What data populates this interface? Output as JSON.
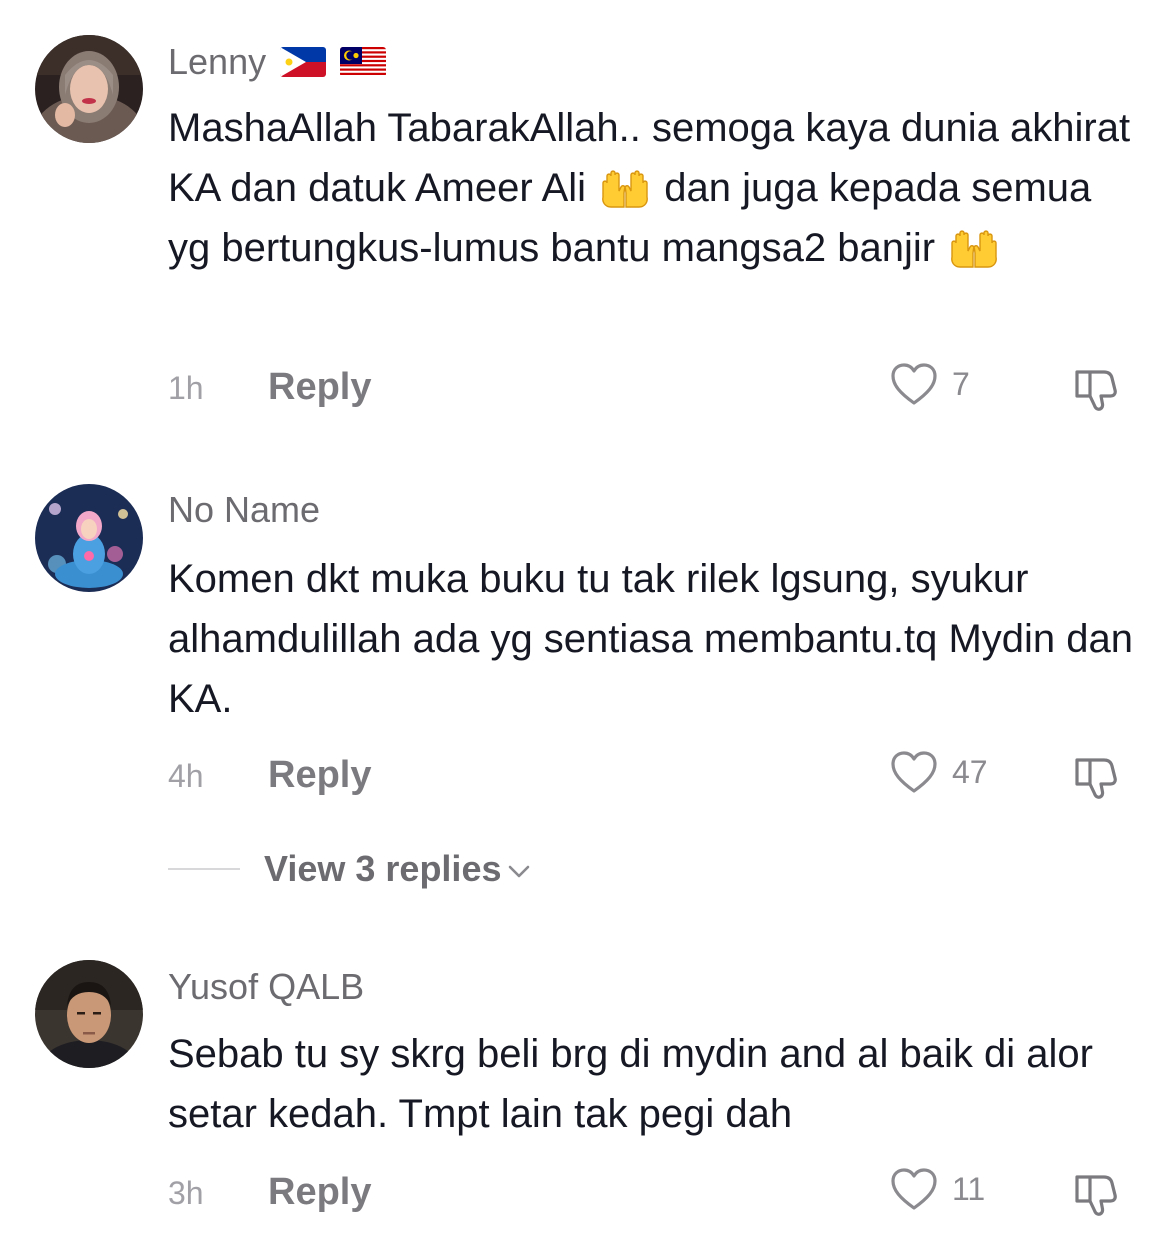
{
  "comments": [
    {
      "username": "Lenny",
      "flags": [
        "philippines-flag",
        "malaysia-flag"
      ],
      "text_parts": [
        "MashaAllah TabarakAllah.. semoga kaya dunia akhirat KA dan datuk Ameer Ali ",
        " dan juga kepada semua yg bertungkus-lumus bantu mangsa2 banjir "
      ],
      "emoji": "palms-up-together-emoji",
      "time": "1h",
      "reply_label": "Reply",
      "likes": "7"
    },
    {
      "username": "No Name",
      "text": "Komen dkt muka buku tu tak rilek lgsung, syukur alhamdulillah ada yg sentiasa membantu.tq Mydin dan KA.",
      "time": "4h",
      "reply_label": "Reply",
      "likes": "47",
      "view_replies": "View 3 replies"
    },
    {
      "username": "Yusof QALB",
      "text": "Sebab tu sy skrg beli brg di mydin and al baik di alor setar kedah. Tmpt lain tak pegi dah",
      "time": "3h",
      "reply_label": "Reply",
      "likes": "11"
    }
  ],
  "icons": {
    "like": "heart-outline-icon",
    "dislike": "thumbs-down-icon",
    "expand": "chevron-down-icon"
  },
  "colors": {
    "username": "#6b6b70",
    "text": "#161823",
    "meta": "#a0a0a6",
    "reply": "#7a7a7f"
  }
}
